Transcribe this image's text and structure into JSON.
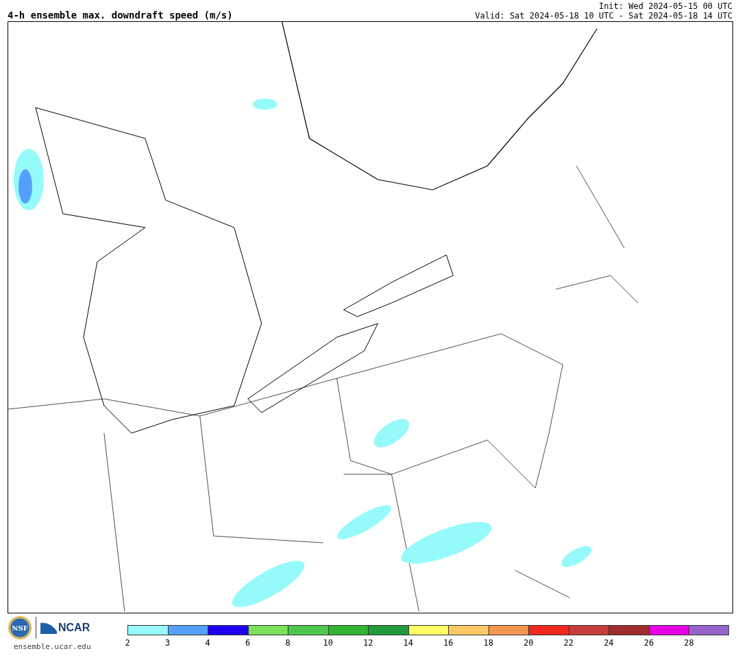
{
  "title": "4-h ensemble max. downdraft speed (m/s)",
  "init": "Init: Wed 2024-05-15 00 UTC",
  "valid": "Valid: Sat 2024-05-18 10 UTC - Sat 2024-05-18 14 UTC",
  "logos": {
    "nsf": "NSF",
    "ncar": "NCAR"
  },
  "url": "ensemble.ucar.edu",
  "colorbar": {
    "segments": [
      {
        "color": "#96fafa",
        "label": "2"
      },
      {
        "color": "#55a0fa",
        "label": "3"
      },
      {
        "color": "#1e00f5",
        "label": "4"
      },
      {
        "color": "#7ce05a",
        "label": "6"
      },
      {
        "color": "#4cc84c",
        "label": "8"
      },
      {
        "color": "#32b432",
        "label": "10"
      },
      {
        "color": "#239b3c",
        "label": "12"
      },
      {
        "color": "#ffff64",
        "label": "14"
      },
      {
        "color": "#fac864",
        "label": "16"
      },
      {
        "color": "#f59650",
        "label": "18"
      },
      {
        "color": "#f0281e",
        "label": "20"
      },
      {
        "color": "#c83c3c",
        "label": "22"
      },
      {
        "color": "#a02d2d",
        "label": "24"
      },
      {
        "color": "#e600e6",
        "label": "26"
      },
      {
        "color": "#9664c8",
        "label": "28"
      }
    ]
  }
}
